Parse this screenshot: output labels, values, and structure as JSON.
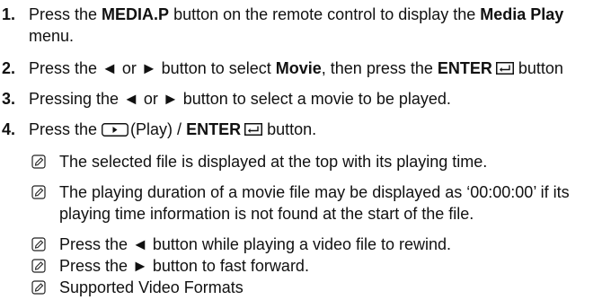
{
  "steps": [
    {
      "num": "1.",
      "pre": "Press the ",
      "b1": "MEDIA.P",
      "mid": " button on the remote control to display the ",
      "b2": "Media Play",
      "line2": "menu."
    },
    {
      "num": "2.",
      "pre": "Press the ◄ or ► button to select ",
      "b1": "Movie",
      "mid": ", then press the ",
      "b2": "ENTER",
      "post": " button"
    },
    {
      "num": "3.",
      "text": "Pressing the ◄ or ► button to select a movie to be played."
    },
    {
      "num": "4.",
      "pre": "Press the ",
      "mid": "(Play) / ",
      "b1": "ENTER",
      "post": " button."
    }
  ],
  "notes": [
    {
      "text": "The selected file is displayed at the top with its playing time."
    },
    {
      "text": "The playing duration of a movie file may be displayed as ‘00:00:00’ if its",
      "line2": "playing time information is not found at the start of the file."
    },
    {
      "text": "Press the ◄ button while playing a video file to rewind."
    },
    {
      "text": "Press the ► button to fast forward."
    },
    {
      "text": "Supported Video Formats"
    }
  ],
  "icons": {
    "note": "note-icon",
    "enter": "enter-icon",
    "play": "play-button-icon"
  }
}
